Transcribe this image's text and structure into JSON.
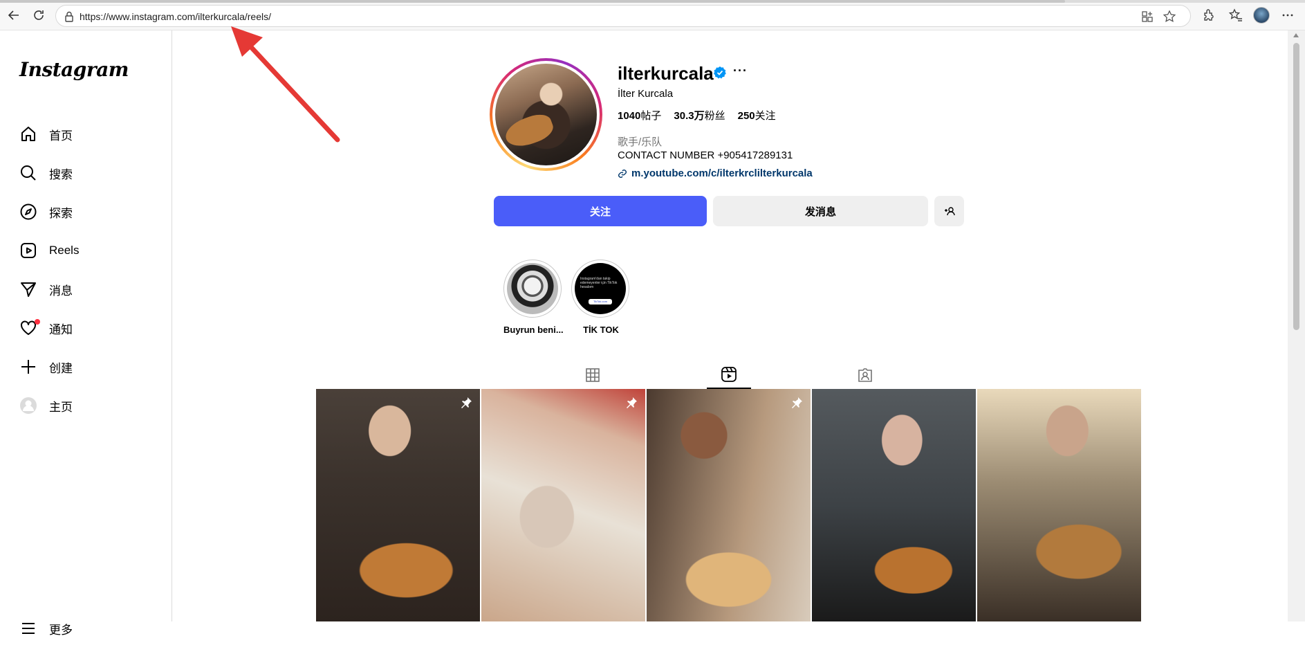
{
  "browser": {
    "url": "https://www.instagram.com/ilterkurcala/reels/"
  },
  "sidebar": {
    "logo": "Instagram",
    "items": [
      {
        "label": "首页",
        "icon": "home-icon"
      },
      {
        "label": "搜索",
        "icon": "search-icon"
      },
      {
        "label": "探索",
        "icon": "compass-icon"
      },
      {
        "label": "Reels",
        "icon": "reels-icon"
      },
      {
        "label": "消息",
        "icon": "send-icon"
      },
      {
        "label": "通知",
        "icon": "heart-icon"
      },
      {
        "label": "创建",
        "icon": "plus-icon"
      },
      {
        "label": "主页",
        "icon": "profile-avatar-icon"
      }
    ],
    "more_label": "更多"
  },
  "profile": {
    "username": "ilterkurcala",
    "full_name": "İlter Kurcala",
    "stats": {
      "posts_count": "1040",
      "posts_label": "帖子",
      "followers_count": "30.3万",
      "followers_label": "粉丝",
      "following_count": "250",
      "following_label": "关注"
    },
    "category": "歌手/乐队",
    "bio": "CONTACT NUMBER +905417289131",
    "link": "m.youtube.com/c/ilterkrclilterkurcala"
  },
  "actions": {
    "follow": "关注",
    "message": "发消息"
  },
  "highlights": [
    {
      "label": "Buyrun beni..."
    },
    {
      "label": "TİK TOK",
      "thumb_text": "Instagram'dan takip edemeyenler için TikTok hesabım",
      "thumb_button": "TikTok.com"
    }
  ],
  "tabs": [
    {
      "name": "posts",
      "icon": "grid-icon",
      "active": false
    },
    {
      "name": "reels",
      "icon": "reels-icon",
      "active": true
    },
    {
      "name": "tagged",
      "icon": "tagged-icon",
      "active": false
    }
  ],
  "reels": [
    {
      "pinned": true
    },
    {
      "pinned": true
    },
    {
      "pinned": true
    },
    {
      "pinned": false
    },
    {
      "pinned": false
    }
  ],
  "colors": {
    "follow_button": "#4a5df9",
    "secondary_button": "#efefef",
    "verified_badge": "#0095f6",
    "notification_dot": "#ff3040",
    "annotation_arrow": "#e53935",
    "link": "#00376b"
  }
}
